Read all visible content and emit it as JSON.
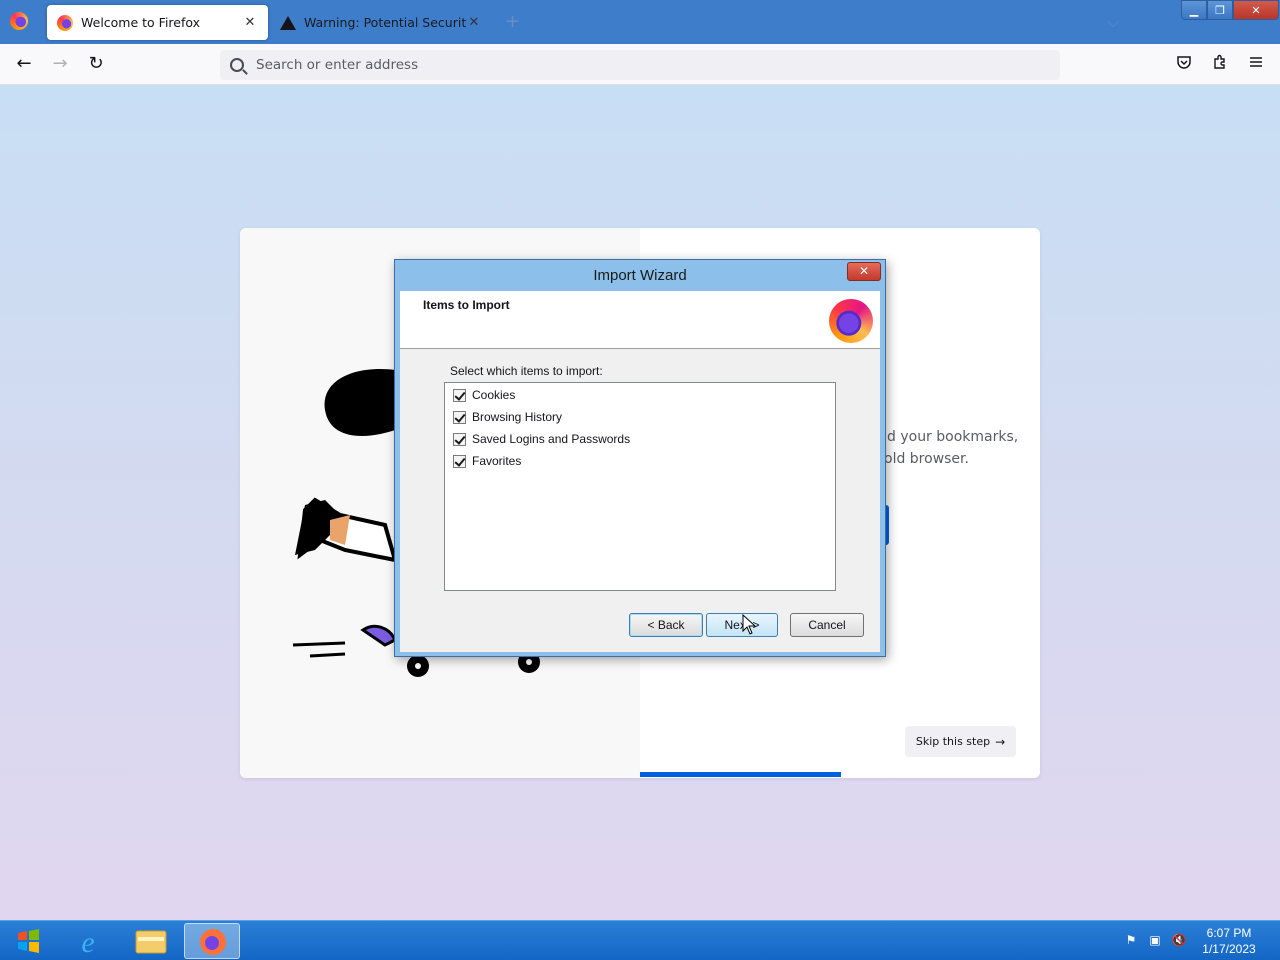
{
  "browser": {
    "tabs": [
      {
        "title": "Welcome to Firefox",
        "active": true,
        "icon": "firefox-icon"
      },
      {
        "title": "Warning: Potential Security Risk",
        "active": false,
        "icon": "warning-icon"
      }
    ],
    "urlbar": {
      "placeholder": "Search or enter address"
    }
  },
  "page": {
    "text_line1": "d your bookmarks,",
    "text_line2": "old browser.",
    "skip_label": "Skip this step"
  },
  "dialog": {
    "title": "Import Wizard",
    "header": "Items to Import",
    "select_label": "Select which items to import:",
    "items": [
      {
        "label": "Cookies",
        "checked": true
      },
      {
        "label": "Browsing History",
        "checked": true
      },
      {
        "label": "Saved Logins and Passwords",
        "checked": true
      },
      {
        "label": "Favorites",
        "checked": true
      }
    ],
    "back_label": "< Back",
    "next_label": "Next >",
    "cancel_label": "Cancel"
  },
  "taskbar": {
    "time": "6:07 PM",
    "date": "1/17/2023"
  },
  "colors": {
    "accent": "#0060df",
    "titlebar": "#3d7dca",
    "taskbar": "#1466c4"
  }
}
